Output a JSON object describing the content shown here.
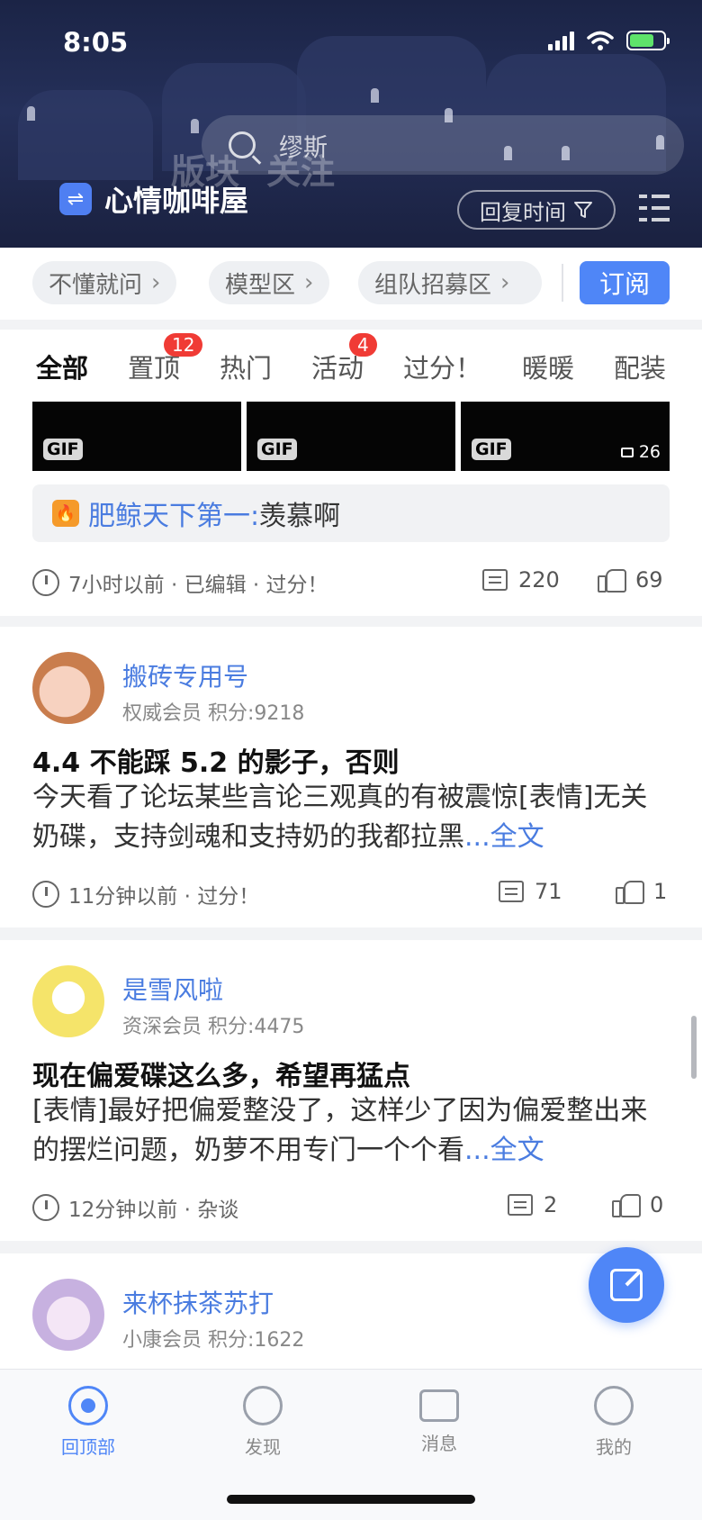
{
  "status": {
    "time": "8:05"
  },
  "header": {
    "search_placeholder": "缪斯",
    "ghost_tabs": [
      "版块",
      "关注"
    ],
    "forum_name": "心情咖啡屋",
    "sort_label": "回复时间",
    "swap_icon": "⇌"
  },
  "subforums": {
    "items": [
      "不懂就问",
      "模型区",
      "组队招募区"
    ],
    "chevron": "›",
    "subscribe_label": "订阅"
  },
  "tabs": [
    {
      "label": "全部",
      "badge": ""
    },
    {
      "label": "置顶",
      "badge": "12"
    },
    {
      "label": "热门",
      "badge": ""
    },
    {
      "label": "活动",
      "badge": "4"
    },
    {
      "label": "过分！",
      "badge": ""
    },
    {
      "label": "暖暖",
      "badge": ""
    },
    {
      "label": "配装",
      "badge": ""
    }
  ],
  "posts": [
    {
      "thumbs": [
        "GIF",
        "GIF",
        "GIF"
      ],
      "image_count": "26",
      "hot_reply": {
        "user": "肥鲸天下第一:",
        "text": " 羡慕啊",
        "fire_icon": "🔥"
      },
      "meta": "7小时以前 · 已编辑 · 过分！",
      "comments": "220",
      "likes": "69"
    },
    {
      "user": "搬砖专用号",
      "rank": "权威会员   积分:9218",
      "title": "4.4 不能踩 5.2 的影子，否则",
      "body": "今天看了论坛某些言论三观真的有被震惊[表情]无关奶碟，支持剑魂和支持奶的我都拉黑",
      "more": "...全文",
      "meta": "11分钟以前 · 过分！",
      "comments": "71",
      "likes": "1"
    },
    {
      "user": "是雪风啦",
      "rank": "资深会员   积分:4475",
      "title": "现在偏爱碟这么多，希望再猛点",
      "body": "[表情]最好把偏爱整没了，这样少了因为偏爱整出来的摆烂问题，奶萝不用专门一个个看",
      "more": "...全文",
      "meta": "12分钟以前 · 杂谈",
      "comments": "2",
      "likes": "0"
    },
    {
      "user": "来杯抹茶苏打",
      "rank": "小康会员   积分:1622"
    }
  ],
  "bottom_nav": [
    "回顶部",
    "发现",
    "消息",
    "我的"
  ]
}
